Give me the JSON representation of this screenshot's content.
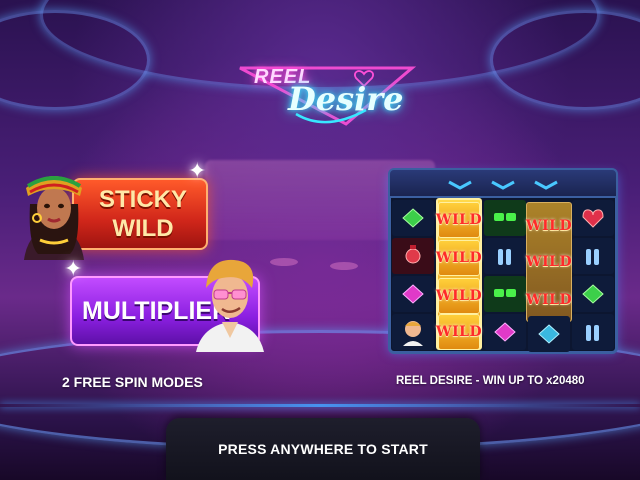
{
  "game": {
    "logo_top": "REEL",
    "logo_main": "Desire"
  },
  "features": {
    "sticky_wild_label_line1": "STICKY",
    "sticky_wild_label_line2": "WILD",
    "multiplier_label": "MULTIPLIER"
  },
  "reels": {
    "wild_label": "WILD"
  },
  "captions": {
    "left": "2 FREE SPIN MODES",
    "right": "REEL DESIRE - WIN UP TO x20480"
  },
  "start": {
    "label": "PRESS ANYWHERE TO START"
  },
  "colors": {
    "neon_blue": "#39e7ff",
    "neon_pink": "#ff4fd8",
    "sticky_red": "#d0261a",
    "multiplier_purple": "#8a1fe0",
    "wild_gold": "#ffcf3a"
  }
}
